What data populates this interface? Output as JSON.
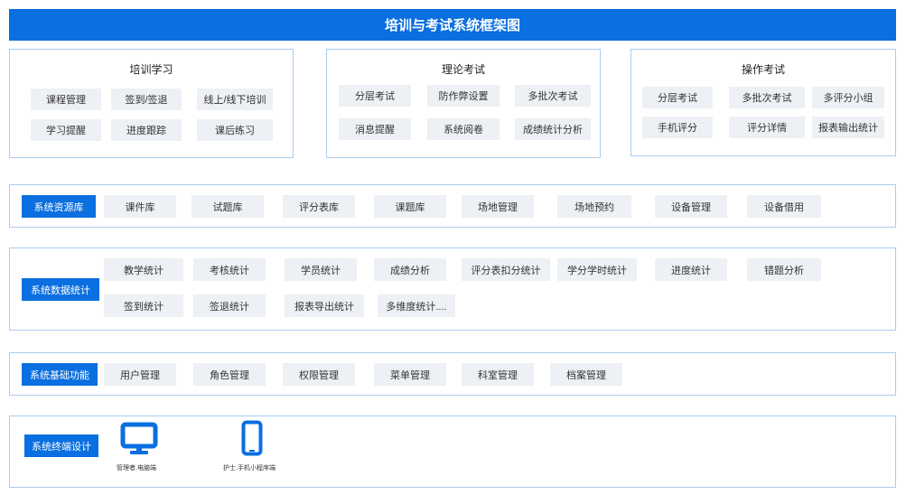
{
  "title": "培训与考试系统框架图",
  "training": {
    "title": "培训学习",
    "items": [
      "课程管理",
      "签到/签退",
      "线上/线下培训",
      "学习提醒",
      "进度跟踪",
      "课后练习"
    ]
  },
  "theory": {
    "title": "理论考试",
    "items": [
      "分层考试",
      "防作弊设置",
      "多批次考试",
      "消息提醒",
      "系统阅卷",
      "成绩统计分析"
    ]
  },
  "practical": {
    "title": "操作考试",
    "items": [
      "分层考试",
      "多批次考试",
      "多评分小组",
      "手机评分",
      "评分详情",
      "报表输出统计"
    ]
  },
  "resources": {
    "label": "系统资源库",
    "items": [
      "课件库",
      "试题库",
      "评分表库",
      "课题库",
      "场地管理",
      "场地预约",
      "设备管理",
      "设备借用"
    ]
  },
  "statistics": {
    "label": "系统数据统计",
    "items": [
      "教学统计",
      "考核统计",
      "学员统计",
      "成绩分析",
      "评分表扣分统计",
      "学分学时统计",
      "进度统计",
      "错题分析",
      "签到统计",
      "签退统计",
      "报表导出统计",
      "多维度统计...."
    ]
  },
  "basic": {
    "label": "系统基础功能",
    "items": [
      "用户管理",
      "角色管理",
      "权限管理",
      "菜单管理",
      "科室管理",
      "档案管理"
    ]
  },
  "terminal": {
    "label": "系统终端设计",
    "devices": [
      {
        "icon": "desktop-monitor-icon",
        "caption": "管理者.电脑端"
      },
      {
        "icon": "mobile-phone-icon",
        "caption": "护士.手机小程序端"
      }
    ]
  },
  "colors": {
    "accent": "#0a6fe0",
    "chip": "#edf0f4",
    "border": "#a9cdf0"
  }
}
